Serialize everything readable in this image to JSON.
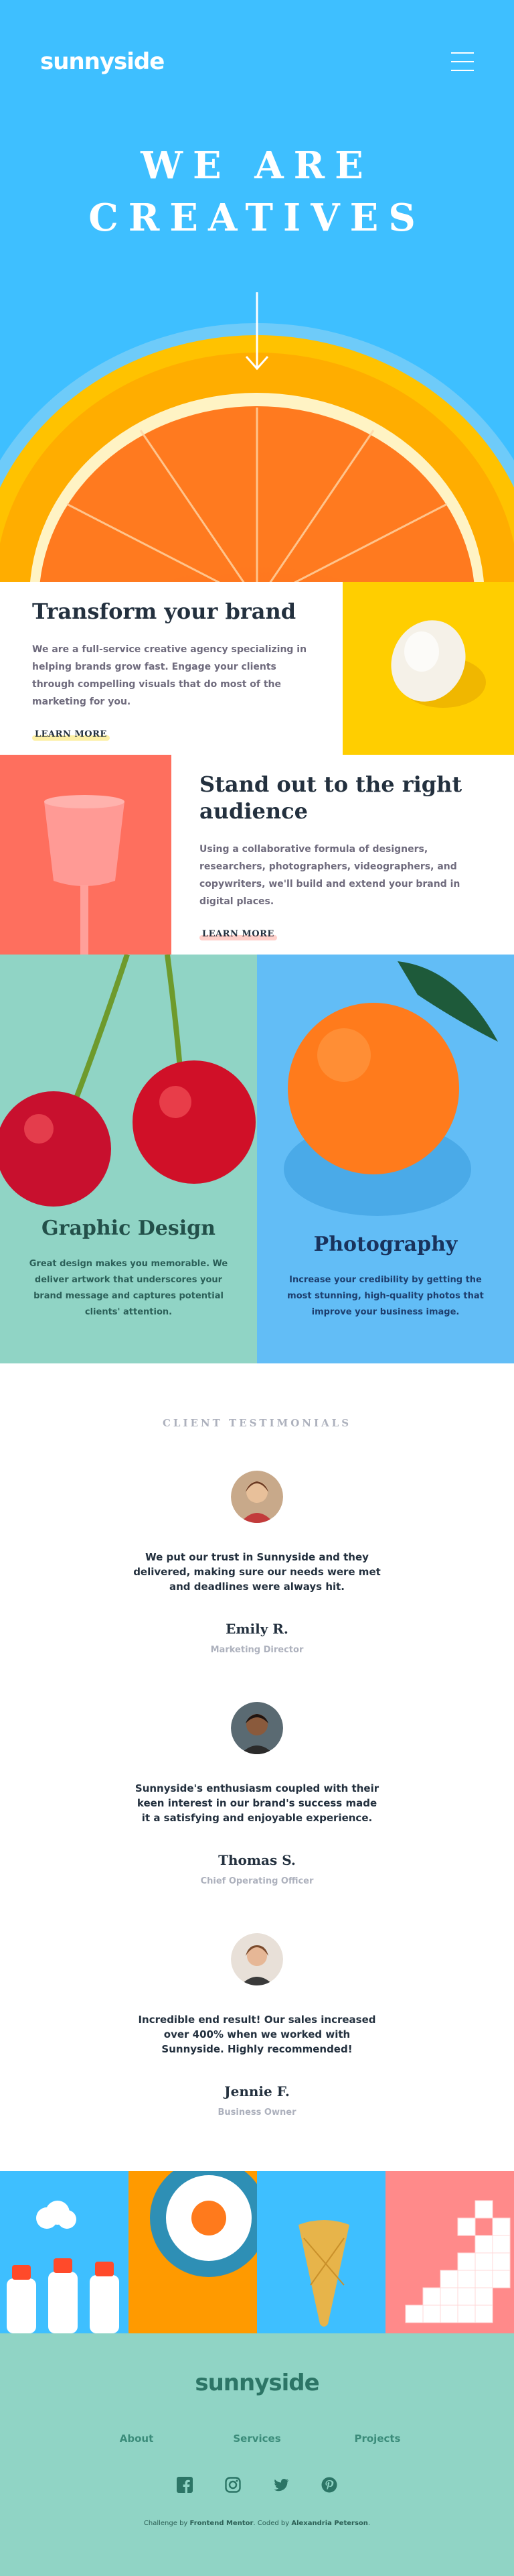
{
  "header": {
    "logo": "sunnyside",
    "menu_icon": "hamburger-icon",
    "hero_title_line1": "WE ARE",
    "hero_title_line2": "CREATIVES",
    "scroll_icon": "arrow-down-icon"
  },
  "features": [
    {
      "title": "Transform your brand",
      "body": "We are a full-service creative agency specializing in helping brands grow fast. Engage your clients through compelling visuals that do most of the marketing for you.",
      "link": "LEARN MORE",
      "accent": "#fad400"
    },
    {
      "title": "Stand out to the right audience",
      "body": "Using a collaborative formula of designers, researchers, photographers, videographers, and copywriters, we'll build and extend your brand in digital places.",
      "link": "LEARN MORE",
      "accent": "#fe7968"
    }
  ],
  "services": [
    {
      "title": "Graphic Design",
      "body": "Great design makes you memorable. We deliver artwork that underscores your brand message and captures potential clients' attention."
    },
    {
      "title": "Photography",
      "body": "Increase your credibility by getting the most stunning, high-quality photos that improve your business image."
    }
  ],
  "testimonials": {
    "label": "CLIENT TESTIMONIALS",
    "items": [
      {
        "quote": "We put our trust in Sunnyside and they delivered, making sure our needs were met and deadlines were always hit.",
        "name": "Emily R.",
        "role": "Marketing Director"
      },
      {
        "quote": "Sunnyside's enthusiasm coupled with their keen interest in our brand's success made it a satisfying and enjoyable experience.",
        "name": "Thomas S.",
        "role": "Chief Operating Officer"
      },
      {
        "quote": "Incredible end result! Our sales increased over 400% when we worked with Sunnyside. Highly recommended!",
        "name": "Jennie F.",
        "role": "Business Owner"
      }
    ]
  },
  "footer": {
    "logo": "sunnyside",
    "nav": [
      "About",
      "Services",
      "Projects"
    ],
    "socials": [
      "facebook-icon",
      "instagram-icon",
      "twitter-icon",
      "pinterest-icon"
    ],
    "attribution_prefix": "Challenge by",
    "attribution_fm": "Frontend Mentor",
    "attribution_mid": ". Coded by",
    "attribution_author": "Alexandria Peterson",
    "attribution_end": "."
  },
  "colors": {
    "hero_bg": "#3ebfff",
    "yellow": "#ffce00",
    "coral": "#fe6f5e",
    "mint": "#90d4c5",
    "sky": "#62bdf6",
    "dark_text": "#23303e"
  }
}
